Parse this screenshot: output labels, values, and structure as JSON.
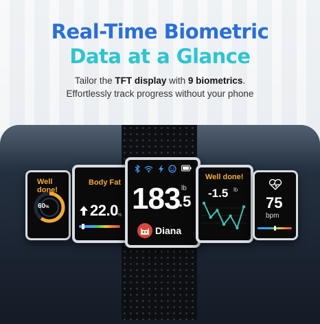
{
  "headline": {
    "line1": "Real-Time Biometric",
    "line2": "Data at a Glance"
  },
  "subtitle": {
    "l1_pre": "Tailor the ",
    "l1_b1": "TFT display",
    "l1_mid": " with ",
    "l1_b2": "9 biometrics",
    "l1_post": ".",
    "l2": "Effortlessly track progress without your phone"
  },
  "screens": {
    "body_comp": {
      "title": "Well done!",
      "value": "60",
      "unit": "%",
      "fraction": 0.6,
      "color": "#f3a936"
    },
    "body_fat": {
      "title": "Body Fat",
      "value": "22.0",
      "unit": "%"
    },
    "weight": {
      "value": "183",
      "decimal": ".5",
      "unit": "lb",
      "user": "Diana",
      "status_icons": [
        "bluetooth-icon",
        "wifi-icon",
        "bolt-icon",
        "smile-icon",
        "battery-icon"
      ]
    },
    "weight_change": {
      "title": "Well done!",
      "value": "-1.5",
      "unit": "lb",
      "trend": [
        4,
        2,
        3,
        1,
        2.2,
        0.5,
        3.5
      ]
    },
    "heart_rate": {
      "value": "75",
      "unit": "bpm"
    }
  },
  "colors": {
    "accent_blue": "#2b6fd8",
    "accent_teal": "#2ec5cf",
    "warn_orange": "#f3a936",
    "line_teal": "#3fc2b4"
  }
}
